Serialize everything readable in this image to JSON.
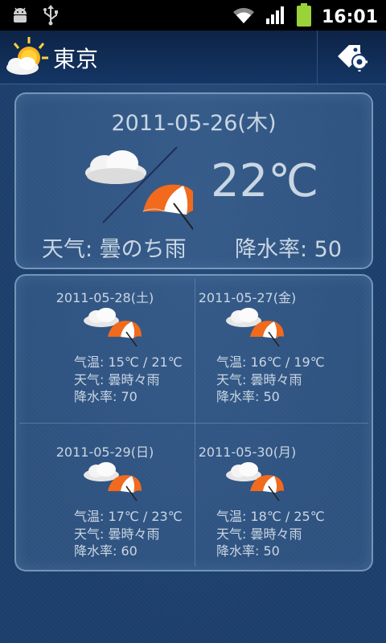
{
  "status_bar": {
    "left_icons": [
      "android-debug-icon",
      "usb-icon"
    ],
    "right_icons": [
      "wifi-icon",
      "signal-icon",
      "battery-icon"
    ],
    "time": "16:01"
  },
  "app_bar": {
    "title": "東京",
    "logo_icon": "sun-cloud-icon",
    "settings_icon": "gear-tag-icon"
  },
  "today": {
    "date": "2011-05-26(木)",
    "temperature": "22℃",
    "condition": "天气: 曇のち雨",
    "precipitation": "降水率: 50",
    "icon": "cloud-then-umbrella-icon"
  },
  "forecast": [
    {
      "date": "2011-05-28(土)",
      "temp": "气温: 15℃ / 21℃",
      "weather": "天气: 曇時々雨",
      "precip": "降水率: 70"
    },
    {
      "date": "2011-05-27(金)",
      "temp": "气温: 16℃ / 19℃",
      "weather": "天气: 曇時々雨",
      "precip": "降水率: 50"
    },
    {
      "date": "2011-05-29(日)",
      "temp": "气温: 17℃ / 23℃",
      "weather": "天气: 曇時々雨",
      "precip": "降水率: 60"
    },
    {
      "date": "2011-05-30(月)",
      "temp": "气温: 18℃ / 25℃",
      "weather": "天气: 曇時々雨",
      "precip": "降水率: 50"
    }
  ],
  "colors": {
    "background": "#1d3f6c",
    "text": "#c9d6e3",
    "umbrella_orange": "#f26a1b",
    "umbrella_white": "#ffffff"
  }
}
